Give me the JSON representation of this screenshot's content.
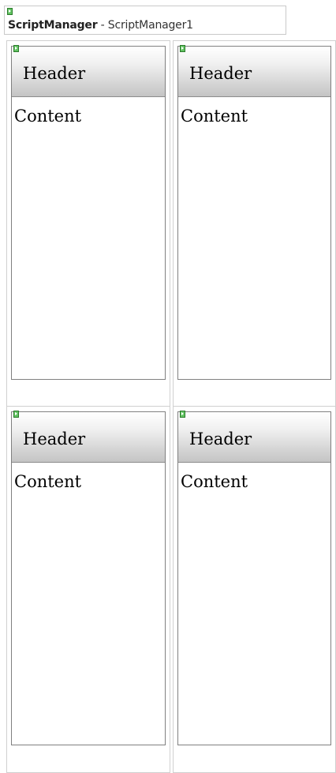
{
  "script_manager": {
    "control_name": "ScriptManager",
    "separator": " - ",
    "instance_id": "ScriptManager1",
    "icon": "smart-tag-icon"
  },
  "panels": [
    {
      "header": "Header",
      "content": "Content"
    },
    {
      "header": "Header",
      "content": "Content"
    },
    {
      "header": "Header",
      "content": "Content"
    },
    {
      "header": "Header",
      "content": "Content"
    }
  ],
  "colors": {
    "panel_border": "#808080",
    "cell_border": "#d0d0d0",
    "header_gradient_top": "#ffffff",
    "header_gradient_bottom": "#c4c4c4",
    "smart_tag_green": "#62c462"
  }
}
